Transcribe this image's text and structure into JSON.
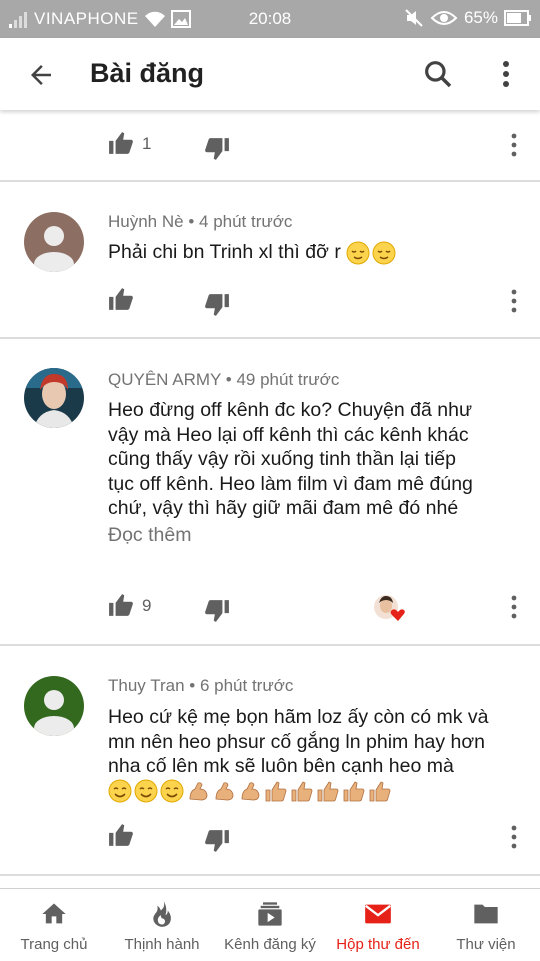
{
  "status_bar": {
    "carrier": "VINAPHONE",
    "time": "20:08",
    "battery": "65%"
  },
  "header": {
    "title": "Bài đăng"
  },
  "comments": [
    {
      "likes": "1"
    },
    {
      "author": "Huỳnh Nè",
      "time": "4 phút trước",
      "text": "Phải chi bn Trinh xl thì đỡ r"
    },
    {
      "author": "QUYÊN ARMY",
      "time": "49 phút trước",
      "text_lines": [
        "Heo đừng off kênh đc ko? Chuyện đã như",
        "vậy mà Heo lại off kênh thì các kênh khác",
        "cũng thấy vậy rồi xuống tinh thần lại tiếp",
        "tục off kênh. Heo làm film vì đam mê đúng",
        "chứ, vậy thì hãy giữ mãi đam mê đó nhé"
      ],
      "read_more": "Đọc thêm",
      "likes": "9"
    },
    {
      "author": "Thuy Tran",
      "time": "6 phút trước",
      "text_lines": [
        "Heo cứ kệ mẹ bọn hãm loz ấy còn có mk và",
        "mn nên heo phsur cố gắng ln phim hay hơn",
        "nha cố lên mk sẽ luôn  bên cạnh heo mà"
      ]
    }
  ],
  "bottom_nav": {
    "items": [
      {
        "label": "Trang chủ",
        "icon": "home-icon"
      },
      {
        "label": "Thịnh hành",
        "icon": "flame-icon"
      },
      {
        "label": "Kênh đăng ký",
        "icon": "subscriptions-icon"
      },
      {
        "label": "Hộp thư đến",
        "icon": "inbox-icon"
      },
      {
        "label": "Thư viện",
        "icon": "library-icon"
      }
    ],
    "active_index": 3
  },
  "colors": {
    "accent": "#e62117",
    "status_bar": "#a8a8a8",
    "icon_gray": "#606060"
  }
}
